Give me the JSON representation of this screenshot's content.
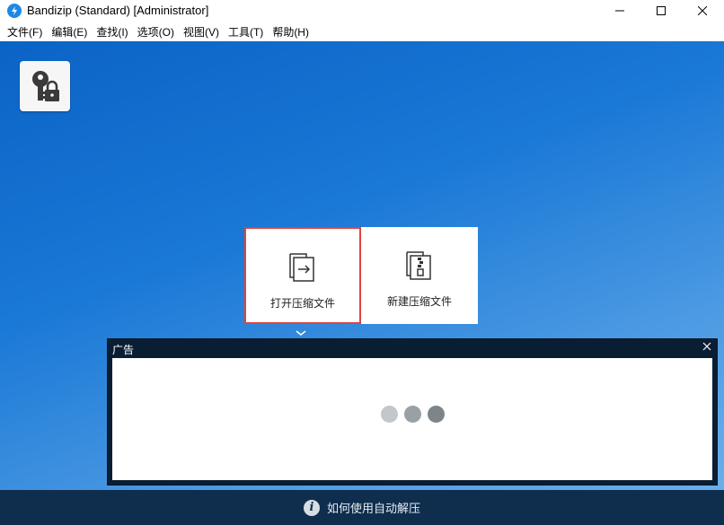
{
  "window": {
    "title": "Bandizip (Standard) [Administrator]",
    "icon": "bandizip-logo-icon"
  },
  "menu": [
    "文件(F)",
    "编辑(E)",
    "查找(I)",
    "选项(O)",
    "视图(V)",
    "工具(T)",
    "帮助(H)"
  ],
  "main": {
    "key_tile_icon": "key-lock-icon",
    "tiles": [
      {
        "label": "打开压缩文件",
        "icon": "open-archive-icon",
        "highlighted": true
      },
      {
        "label": "新建压缩文件",
        "icon": "new-archive-icon",
        "highlighted": false
      }
    ]
  },
  "ad": {
    "title": "广告",
    "loading_dot_colors": [
      "#c4c7ca",
      "#9aa1a5",
      "#7e8589"
    ]
  },
  "bottom_bar": {
    "text": "如何使用自动解压",
    "icon": "info-icon"
  },
  "colors": {
    "highlight_border": "#e0443e",
    "bottom_bar_bg": "#0f2e4e",
    "ad_frame_bg": "#0a1e33"
  }
}
